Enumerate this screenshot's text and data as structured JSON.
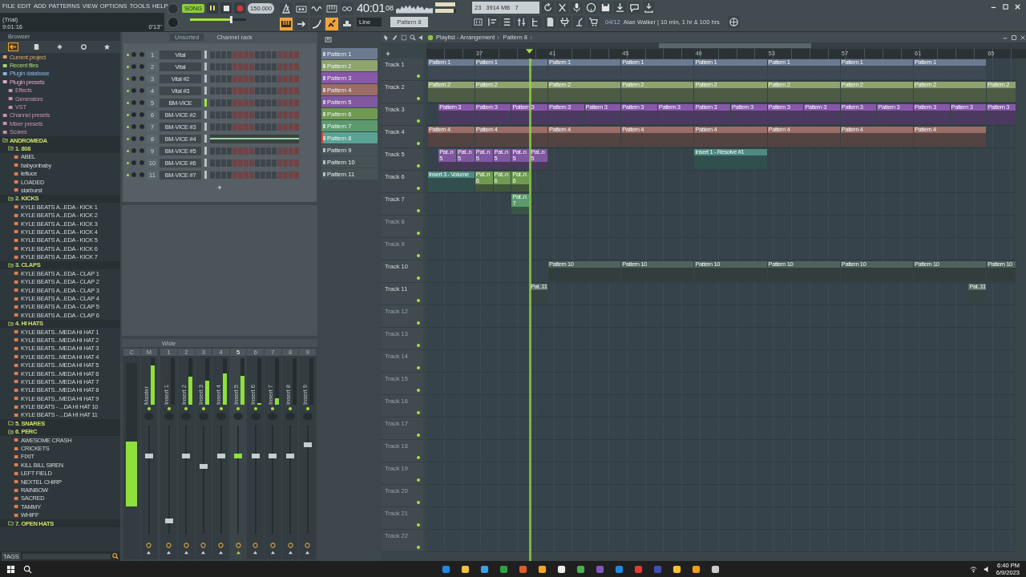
{
  "menu": [
    "FILE",
    "EDIT",
    "ADD",
    "PATTERNS",
    "VIEW",
    "OPTIONS",
    "TOOLS",
    "HELP"
  ],
  "session": {
    "status": "(Trial)",
    "clock": "9:01:16",
    "elapsed": "0'13\""
  },
  "transport": {
    "mode": "SONG",
    "song_mode": true,
    "playing": true,
    "recording": false,
    "tempo": "150.000",
    "master_volume": {
      "level": 0.72
    }
  },
  "time": {
    "main": "40:01",
    "sub": "08"
  },
  "output_meter": [
    {
      "level": 0.96
    },
    {
      "level": 0.9
    }
  ],
  "cpu": {
    "value": "23",
    "memory": "3914 MB",
    "polyphony": "7"
  },
  "snap": "Line",
  "pattern_selector": "Pattern 8",
  "hint": {
    "counter": "04/12",
    "text": "Alan Walker | 10 min, 1 hr & 100 hrs"
  },
  "browser": {
    "title": "Browser",
    "tags": "TAGS",
    "items": [
      {
        "label": "Current project",
        "kind": "link",
        "color": "#d9a066"
      },
      {
        "label": "Recent files",
        "kind": "link",
        "color": "#a6d66e"
      },
      {
        "label": "Plugin database",
        "kind": "link",
        "color": "#86b4e0"
      },
      {
        "label": "Plugin presets",
        "kind": "link",
        "color": "#e3a7c8",
        "children": [
          {
            "label": "Effects",
            "kind": "link",
            "color": "#c58fae"
          },
          {
            "label": "Generators",
            "kind": "link",
            "color": "#c58fae"
          },
          {
            "label": "VST",
            "kind": "link",
            "color": "#c58fae"
          }
        ]
      },
      {
        "label": "Channel presets",
        "kind": "link",
        "color": "#c58fae"
      },
      {
        "label": "Mixer presets",
        "kind": "link",
        "color": "#c58fae"
      },
      {
        "label": "Scores",
        "kind": "link",
        "color": "#c58fae"
      },
      {
        "label": "ANDROMEDA",
        "kind": "folder",
        "expanded": true,
        "children": [
          {
            "label": "1. 808",
            "kind": "folder",
            "expanded": true,
            "children": [
              {
                "label": "ABEL",
                "kind": "file"
              },
              {
                "label": "babyonbaby",
                "kind": "file"
              },
              {
                "label": "lettuce",
                "kind": "file"
              },
              {
                "label": "LOADED",
                "kind": "file"
              },
              {
                "label": "starburst",
                "kind": "file"
              }
            ]
          },
          {
            "label": "2. KICKS",
            "kind": "folder",
            "expanded": true,
            "children": [
              {
                "label": "KYLE BEATS A...EDA - KICK 1",
                "kind": "file"
              },
              {
                "label": "KYLE BEATS A...EDA - KICK 2",
                "kind": "file"
              },
              {
                "label": "KYLE BEATS A...EDA - KICK 3",
                "kind": "file"
              },
              {
                "label": "KYLE BEATS A...EDA - KICK 4",
                "kind": "file"
              },
              {
                "label": "KYLE BEATS A...EDA - KICK 5",
                "kind": "file"
              },
              {
                "label": "KYLE BEATS A...EDA - KICK 6",
                "kind": "file"
              },
              {
                "label": "KYLE BEATS A...EDA - KICK 7",
                "kind": "file"
              }
            ]
          },
          {
            "label": "3. CLAPS",
            "kind": "folder",
            "expanded": true,
            "children": [
              {
                "label": "KYLE BEATS A...EDA - CLAP 1",
                "kind": "file"
              },
              {
                "label": "KYLE BEATS A...EDA - CLAP 2",
                "kind": "file"
              },
              {
                "label": "KYLE BEATS A...EDA - CLAP 3",
                "kind": "file"
              },
              {
                "label": "KYLE BEATS A...EDA - CLAP 4",
                "kind": "file"
              },
              {
                "label": "KYLE BEATS A...EDA - CLAP 5",
                "kind": "file"
              },
              {
                "label": "KYLE BEATS A...EDA - CLAP 6",
                "kind": "file"
              }
            ]
          },
          {
            "label": "4. HI HATS",
            "kind": "folder",
            "expanded": true,
            "children": [
              {
                "label": "KYLE BEATS...MEDA HI HAT 1",
                "kind": "file"
              },
              {
                "label": "KYLE BEATS...MEDA HI HAT 2",
                "kind": "file"
              },
              {
                "label": "KYLE BEATS...MEDA HI HAT 3",
                "kind": "file"
              },
              {
                "label": "KYLE BEATS...MEDA HI HAT 4",
                "kind": "file"
              },
              {
                "label": "KYLE BEATS...MEDA HI HAT 5",
                "kind": "file"
              },
              {
                "label": "KYLE BEATS...MEDA HI HAT 6",
                "kind": "file"
              },
              {
                "label": "KYLE BEATS...MEDA HI HAT 7",
                "kind": "file"
              },
              {
                "label": "KYLE BEATS...MEDA HI HAT 8",
                "kind": "file"
              },
              {
                "label": "KYLE BEATS...MEDA HI HAT 9",
                "kind": "file"
              },
              {
                "label": "KYLE BEATS - ...DA HI HAT 10",
                "kind": "file"
              },
              {
                "label": "KYLE BEATS - ...DA HI HAT 11",
                "kind": "file"
              }
            ]
          },
          {
            "label": "5. SNARES",
            "kind": "folder",
            "expanded": false
          },
          {
            "label": "6. PERC",
            "kind": "folder",
            "expanded": true,
            "children": [
              {
                "label": "AWESOME CRASH",
                "kind": "file"
              },
              {
                "label": "CRICKETS",
                "kind": "file"
              },
              {
                "label": "FIXIT",
                "kind": "file"
              },
              {
                "label": "KILL BILL SIREN",
                "kind": "file"
              },
              {
                "label": "LEFT FIELD",
                "kind": "file"
              },
              {
                "label": "NEXTEL CHIRP",
                "kind": "file"
              },
              {
                "label": "RAINBOW",
                "kind": "file"
              },
              {
                "label": "SACRED",
                "kind": "file"
              },
              {
                "label": "TAMMY",
                "kind": "file"
              },
              {
                "label": "WHIFF",
                "kind": "file"
              }
            ]
          },
          {
            "label": "7. OPEN HATS",
            "kind": "folder",
            "expanded": false
          }
        ]
      }
    ]
  },
  "channel_rack": {
    "filter": "Unsorted",
    "title": "Channel rack",
    "channels": [
      {
        "number": "1",
        "name": "Vital",
        "kind": "steps",
        "selected": false
      },
      {
        "number": "2",
        "name": "Vital",
        "kind": "steps",
        "selected": false
      },
      {
        "number": "3",
        "name": "Vital #2",
        "kind": "steps",
        "selected": false
      },
      {
        "number": "4",
        "name": "Vital #3",
        "kind": "steps",
        "selected": false
      },
      {
        "number": "5",
        "name": "BM-VICE",
        "kind": "steps",
        "selected": true
      },
      {
        "number": "6",
        "name": "BM-VICE #2",
        "kind": "steps",
        "selected": false
      },
      {
        "number": "7",
        "name": "BM-VICE #3",
        "kind": "steps",
        "selected": false
      },
      {
        "number": "8",
        "name": "BM-VICE #4",
        "kind": "pianoroll",
        "selected": false
      },
      {
        "number": "9",
        "name": "BM-VICE #5",
        "kind": "steps",
        "selected": false
      },
      {
        "number": "10",
        "name": "BM-VICE #6",
        "kind": "steps",
        "selected": false
      },
      {
        "number": "11",
        "name": "BM-VICE #7",
        "kind": "steps",
        "selected": false
      }
    ]
  },
  "mixer": {
    "preset": "Wide",
    "strips": [
      {
        "number": "C",
        "kind": "current",
        "selected": false,
        "meter": {
          "level": 0.45
        }
      },
      {
        "number": "M",
        "label": "Master",
        "kind": "insert",
        "selected": false,
        "meter": {
          "level": 0.85
        },
        "fader": {
          "level": 0.72
        }
      },
      {
        "number": "1",
        "label": "Insert 1",
        "kind": "insert",
        "selected": false,
        "meter": {
          "level": 0
        },
        "fader": {
          "level": 0.12
        }
      },
      {
        "number": "2",
        "label": "Insert 2",
        "kind": "insert",
        "selected": false,
        "meter": {
          "level": 0.6
        },
        "fader": {
          "level": 0.72
        }
      },
      {
        "number": "3",
        "label": "Insert 3",
        "kind": "insert",
        "selected": false,
        "meter": {
          "level": 0.52
        },
        "fader": {
          "level": 0.62
        }
      },
      {
        "number": "4",
        "label": "Insert 4",
        "kind": "insert",
        "selected": false,
        "meter": {
          "level": 0.68
        },
        "fader": {
          "level": 0.72
        }
      },
      {
        "number": "5",
        "label": "Insert 5",
        "kind": "insert",
        "selected": true,
        "meter": {
          "level": 0.62
        },
        "fader": {
          "level": 0.72
        }
      },
      {
        "number": "6",
        "label": "Insert 6",
        "kind": "insert",
        "selected": false,
        "meter": {
          "level": 0.03
        },
        "fader": {
          "level": 0.72
        }
      },
      {
        "number": "7",
        "label": "Insert 7",
        "kind": "insert",
        "selected": false,
        "meter": {
          "level": 0.14
        },
        "fader": {
          "level": 0.72
        }
      },
      {
        "number": "8",
        "label": "Insert 8",
        "kind": "insert",
        "selected": false,
        "meter": {
          "level": 0
        },
        "fader": {
          "level": 0.72
        }
      },
      {
        "number": "9",
        "label": "Insert 9",
        "kind": "insert",
        "selected": false,
        "meter": {
          "level": 0
        },
        "fader": {
          "level": 0.82
        }
      }
    ]
  },
  "patterns": [
    {
      "label": "Pattern 1",
      "color": "#6c7a90",
      "selected": false
    },
    {
      "label": "Pattern 2",
      "color": "#8ea36e",
      "selected": false
    },
    {
      "label": "Pattern 3",
      "color": "#8758a8",
      "selected": false
    },
    {
      "label": "Pattern 4",
      "color": "#9a6d66",
      "selected": false
    },
    {
      "label": "Pattern 5",
      "color": "#8058a0",
      "selected": false
    },
    {
      "label": "Pattern 6",
      "color": "#6f9a52",
      "selected": false
    },
    {
      "label": "Pattern 7",
      "color": "#5c9a6e",
      "selected": false
    },
    {
      "label": "Pattern 8",
      "color": "#5aa394",
      "selected": true
    },
    {
      "label": "Pattern 9",
      "color": "#475257",
      "selected": false
    },
    {
      "label": "Pattern 10",
      "color": "#475257",
      "selected": false
    },
    {
      "label": "Pattern 11",
      "color": "#475257",
      "selected": false
    }
  ],
  "playlist": {
    "title": "Playlist - Arrangement",
    "pattern": "Pattern 8",
    "ruler": [
      "37",
      "41",
      "45",
      "49",
      "53",
      "57",
      "61",
      "65"
    ],
    "tracks": [
      {
        "name": "Track 1",
        "color": "#6c7a90",
        "clips": [
          {
            "label": "Pattern 1",
            "kind": "pattern"
          },
          {
            "label": "Pattern 1",
            "kind": "pattern"
          },
          {
            "label": "Pattern 1",
            "kind": "pattern"
          },
          {
            "label": "Pattern 1",
            "kind": "pattern"
          },
          {
            "label": "Pattern 1",
            "kind": "pattern"
          },
          {
            "label": "Pattern 1",
            "kind": "pattern"
          },
          {
            "label": "Pattern 1",
            "kind": "pattern"
          },
          {
            "label": "Pattern 1",
            "kind": "pattern"
          }
        ]
      },
      {
        "name": "Track 2",
        "color": "#8ea36e",
        "clips": [
          {
            "label": "Pattern 2",
            "kind": "pattern"
          },
          {
            "label": "Pattern 2",
            "kind": "pattern"
          },
          {
            "label": "Pattern 2",
            "kind": "pattern"
          },
          {
            "label": "Pattern 2",
            "kind": "pattern"
          },
          {
            "label": "Pattern 2",
            "kind": "pattern"
          },
          {
            "label": "Pattern 2",
            "kind": "pattern"
          },
          {
            "label": "Pattern 2",
            "kind": "pattern"
          },
          {
            "label": "Pattern 2",
            "kind": "pattern"
          },
          {
            "label": "Pattern 2",
            "kind": "pattern"
          }
        ]
      },
      {
        "name": "Track 3",
        "color": "#8758a8",
        "clips": [
          {
            "label": "Pattern 3",
            "kind": "pattern"
          },
          {
            "label": "Pattern 3",
            "kind": "pattern"
          },
          {
            "label": "Pattern 3",
            "kind": "pattern"
          },
          {
            "label": "Pattern 3",
            "kind": "pattern"
          },
          {
            "label": "Pattern 3",
            "kind": "pattern"
          },
          {
            "label": "Pattern 3",
            "kind": "pattern"
          },
          {
            "label": "Pattern 3",
            "kind": "pattern"
          },
          {
            "label": "Pattern 3",
            "kind": "pattern"
          },
          {
            "label": "Pattern 3",
            "kind": "pattern"
          },
          {
            "label": "Pattern 3",
            "kind": "pattern"
          },
          {
            "label": "Pattern 3",
            "kind": "pattern"
          },
          {
            "label": "Pattern 3",
            "kind": "pattern"
          },
          {
            "label": "Pattern 3",
            "kind": "pattern"
          },
          {
            "label": "Pattern 3",
            "kind": "pattern"
          },
          {
            "label": "Pattern 3",
            "kind": "pattern"
          },
          {
            "label": "Pattern 3",
            "kind": "pattern"
          }
        ]
      },
      {
        "name": "Track 4",
        "color": "#9a6d66",
        "clips": [
          {
            "label": "Pattern 4",
            "kind": "pattern"
          },
          {
            "label": "Pattern 4",
            "kind": "pattern"
          },
          {
            "label": "Pattern 4",
            "kind": "pattern"
          },
          {
            "label": "Pattern 4",
            "kind": "pattern"
          },
          {
            "label": "Pattern 4",
            "kind": "pattern"
          },
          {
            "label": "Pattern 4",
            "kind": "pattern"
          },
          {
            "label": "Pattern 4",
            "kind": "pattern"
          },
          {
            "label": "Pattern 4",
            "kind": "pattern"
          }
        ]
      },
      {
        "name": "Track 5",
        "color": "#8058a0",
        "clips": [
          {
            "label": "Pat..n 5",
            "kind": "pattern"
          },
          {
            "label": "Pat..n 5",
            "kind": "pattern"
          },
          {
            "label": "Pat..n 5",
            "kind": "pattern"
          },
          {
            "label": "Pat..n 5",
            "kind": "pattern"
          },
          {
            "label": "Pat..n 5",
            "kind": "pattern"
          },
          {
            "label": "Pat..n 5",
            "kind": "pattern"
          },
          {
            "label": "Insert 1 - Resolve #1",
            "kind": "automation"
          }
        ]
      },
      {
        "name": "Track 6",
        "color": "#6f9a52",
        "clips": [
          {
            "label": "Insert 3 - Volume",
            "kind": "automation"
          },
          {
            "label": "Pat..n 6",
            "kind": "pattern"
          },
          {
            "label": "Pat..n 6",
            "kind": "pattern"
          },
          {
            "label": "Pat..n 6",
            "kind": "pattern"
          }
        ]
      },
      {
        "name": "Track 7",
        "color": "#5c9a6e",
        "clips": [
          {
            "label": "Pat..n 7",
            "kind": "pattern"
          }
        ]
      },
      {
        "name": "Track 8"
      },
      {
        "name": "Track 9"
      },
      {
        "name": "Track 10",
        "color": "#51625e",
        "clips": [
          {
            "label": "Pattern 10",
            "kind": "pattern"
          },
          {
            "label": "Pattern 10",
            "kind": "pattern"
          },
          {
            "label": "Pattern 10",
            "kind": "pattern"
          },
          {
            "label": "Pattern 10",
            "kind": "pattern"
          },
          {
            "label": "Pattern 10",
            "kind": "pattern"
          },
          {
            "label": "Pattern 10",
            "kind": "pattern"
          },
          {
            "label": "Pattern 10",
            "kind": "pattern"
          }
        ]
      },
      {
        "name": "Track 11",
        "color": "#5b6c68",
        "clips": [
          {
            "label": "Pat..11",
            "kind": "pattern"
          },
          {
            "label": "Pat..11",
            "kind": "pattern"
          }
        ]
      },
      {
        "name": "Track 12"
      },
      {
        "name": "Track 13"
      },
      {
        "name": "Track 14"
      },
      {
        "name": "Track 15"
      },
      {
        "name": "Track 16"
      },
      {
        "name": "Track 17"
      },
      {
        "name": "Track 18"
      },
      {
        "name": "Track 19"
      },
      {
        "name": "Track 20"
      },
      {
        "name": "Track 21"
      },
      {
        "name": "Track 22"
      }
    ]
  },
  "taskbar": {
    "time": "6:40 PM",
    "date": "6/9/2023"
  }
}
